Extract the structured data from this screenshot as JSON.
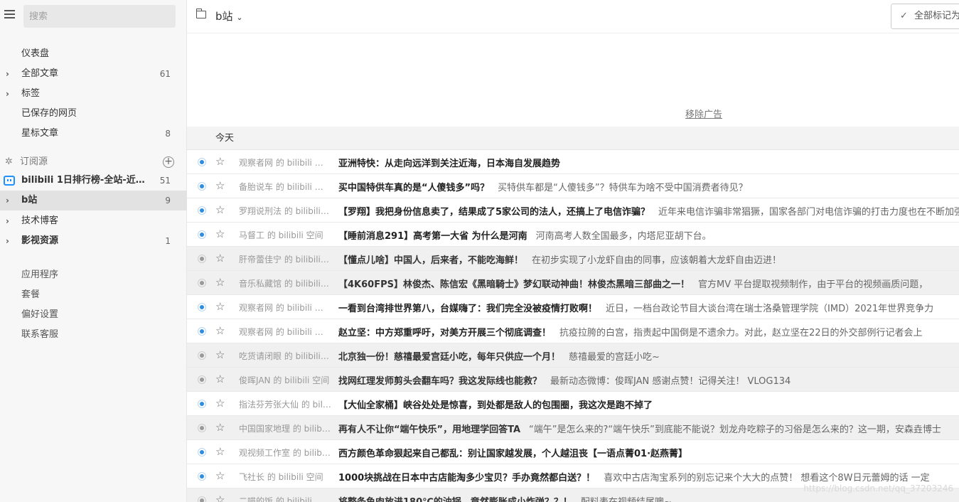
{
  "search": {
    "placeholder": "搜索"
  },
  "sidebar": {
    "items": [
      {
        "label": "仪表盘",
        "count": ""
      },
      {
        "label": "全部文章",
        "count": "61"
      },
      {
        "label": "标签",
        "count": ""
      },
      {
        "label": "已保存的网页",
        "count": ""
      },
      {
        "label": "星标文章",
        "count": "8"
      }
    ],
    "subscriptions_label": "订阅源",
    "feeds": [
      {
        "label": "bilibili 1日排行榜-全站-近期...",
        "count": "51"
      },
      {
        "label": "b站",
        "count": "9"
      },
      {
        "label": "技术博客",
        "count": ""
      },
      {
        "label": "影视资源",
        "count": "1"
      }
    ],
    "footer": [
      {
        "label": "应用程序"
      },
      {
        "label": "套餐"
      },
      {
        "label": "偏好设置"
      },
      {
        "label": "联系客服"
      }
    ]
  },
  "header": {
    "title": "b站",
    "mark_all": "全部标记为已读"
  },
  "ad": {
    "remove_label": "移除广告"
  },
  "date_label": "今天",
  "articles": [
    {
      "source": "观察者网 的 bilibili 空间",
      "title": "亚洲特快：从走向远洋到关注近海，日本海自发展趋势",
      "summary": "",
      "read": false
    },
    {
      "source": "备胎说车 的 bilibili 空间",
      "title": "买中国特供车真的是“人傻钱多”吗？",
      "summary": "买特供车都是“人傻钱多”？特供车为啥不受中国消费者待见？",
      "read": false
    },
    {
      "source": "罗翔说刑法 的 bilibili ...",
      "title": "【罗翔】我把身份信息卖了，结果成了5家公司的法人，还搞上了电信诈骗？",
      "summary": "近年来电信诈骗非常猖獗，国家各部门对电信诈骗的打击力度也在不断加强",
      "read": false
    },
    {
      "source": "马督工 的 bilibili 空间",
      "title": "【睡前消息291】高考第一大省 为什么是河南",
      "summary": "河南高考人数全国最多，内塔尼亚胡下台。",
      "read": false
    },
    {
      "source": "肝帝蕾佳宁 的 bilibili ...",
      "title": "【懂点儿啥】中国人，后来者，不能吃海鲜！",
      "summary": "在初步实现了小龙虾自由的同事，应该朝着大龙虾自由迈进！",
      "read": true
    },
    {
      "source": "音乐私藏馆 的 bilibili ...",
      "title": "【4K60FPS】林俊杰、陈信宏《黑暗騎士》梦幻联动神曲！林俊杰黑暗三部曲之一！",
      "summary": "官方MV 平台提取视频制作，由于平台的视频画质问题，",
      "read": true
    },
    {
      "source": "观察者网 的 bilibili 空间",
      "title": "一看到台湾排世界第八，台媒嗨了：我们完全没被疫情打败啊！",
      "summary": "近日，一档台政论节目大谈台湾在瑞士洛桑管理学院（IMD）2021年世界竞争力",
      "read": false
    },
    {
      "source": "观察者网 的 bilibili 空间",
      "title": "赵立坚：中方郑重呼吁，对美方开展三个彻底调查！",
      "summary": "抗疫拉胯的白宫，指责起中国倒是不遗余力。对此，赵立坚在22日的外交部例行记者会上",
      "read": false
    },
    {
      "source": "吃货请闭眼 的 bilibili ...",
      "title": "北京独一份！慈禧最爱宫廷小吃，每年只供应一个月！",
      "summary": "慈禧最爱的宫廷小吃~",
      "read": true
    },
    {
      "source": "俊晖JAN 的 bilibili 空间",
      "title": "找网红理发师剪头会翻车吗？我这发际线也能救？",
      "summary": "最新动态微博：俊晖JAN 感谢点赞！记得关注！ VLOG134",
      "read": true
    },
    {
      "source": "指法芬芳张大仙 的 bili...",
      "title": "【大仙全家桶】峡谷处处是惊喜，到处都是敌人的包围圈，我这次是跑不掉了",
      "summary": "",
      "read": false
    },
    {
      "source": "中国国家地理 的 bilibili...",
      "title": "再有人不让你“端午快乐”，用地理学回答TA",
      "summary": "“端午”是怎么来的?“端午快乐”到底能不能说？划龙舟吃粽子的习俗是怎么来的？这一期，安森垚博士",
      "read": true
    },
    {
      "source": "观视频工作室 的 bilibili...",
      "title": "西方颜色革命狠起来自己都乱：别让国家越发展，个人越沮丧【一语点菁01·赵燕菁】",
      "summary": "",
      "read": false
    },
    {
      "source": "飞社长 的 bilibili 空间",
      "title": "1000块挑战在日本中古店能淘多少宝贝？手办竟然都白送？！",
      "summary": "喜欢中古店淘宝系列的别忘记来个大大的点赞！ 想看这个8W日元蕾姆的话 一定",
      "read": false
    },
    {
      "source": "二喵的饭 的 bilibili 空间",
      "title": "将整条鱼肉放进180℃的油锅，竟然膨胀成小炸弹？？！",
      "summary": "配料表在视频结尾噢~",
      "read": true
    }
  ],
  "watermark": "https://blog.csdn.net/qq_37203246"
}
